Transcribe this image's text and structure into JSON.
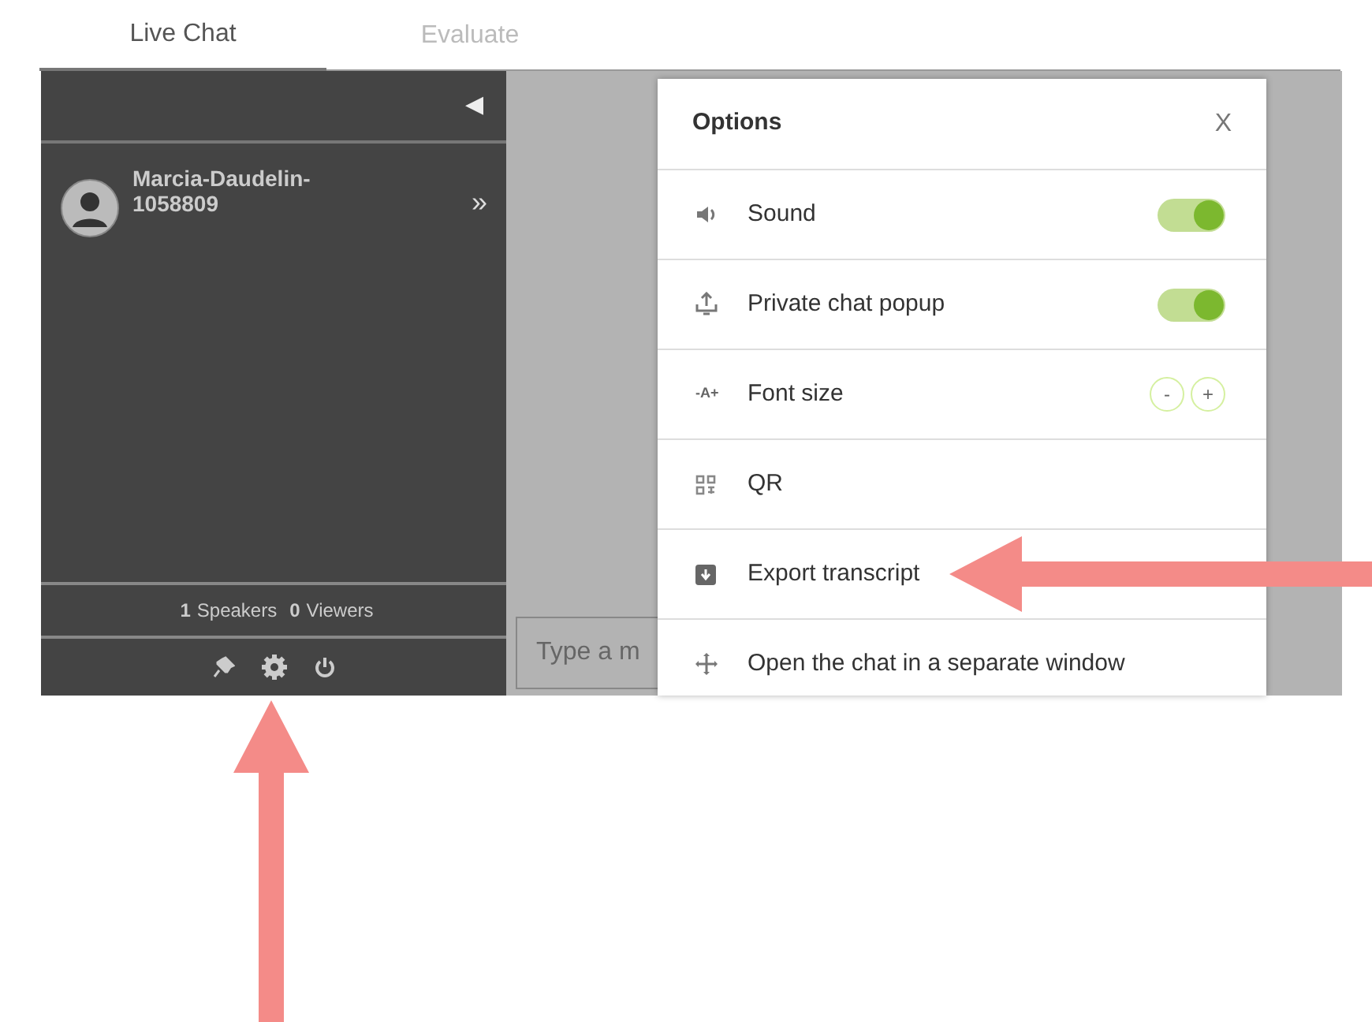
{
  "tabs": [
    {
      "label": "Live Chat",
      "selected": true
    },
    {
      "label": "Evaluate",
      "selected": false
    }
  ],
  "sidebar": {
    "collapse_glyph": "◀",
    "contacts": [
      {
        "name": "Marcia-Daudelin-1058809",
        "open_glyph": "»"
      }
    ],
    "stats": [
      {
        "count": "1",
        "label": "Speakers"
      },
      {
        "count": "0",
        "label": "Viewers"
      }
    ]
  },
  "message_input": {
    "placeholder": "Type a m"
  },
  "options_dialog": {
    "title": "Options",
    "close": "X",
    "rows": [
      {
        "kind": "toggle",
        "label": "Sound",
        "on": true
      },
      {
        "kind": "toggle",
        "label": "Private chat popup",
        "on": true
      },
      {
        "kind": "stepper",
        "label": "Font size",
        "icon_text": "-A+",
        "decrease": "-",
        "increase": "+"
      },
      {
        "kind": "plain",
        "label": "QR"
      },
      {
        "kind": "plain",
        "label": "Export transcript"
      },
      {
        "kind": "plain",
        "label": "Open the chat in a separate window"
      }
    ]
  }
}
